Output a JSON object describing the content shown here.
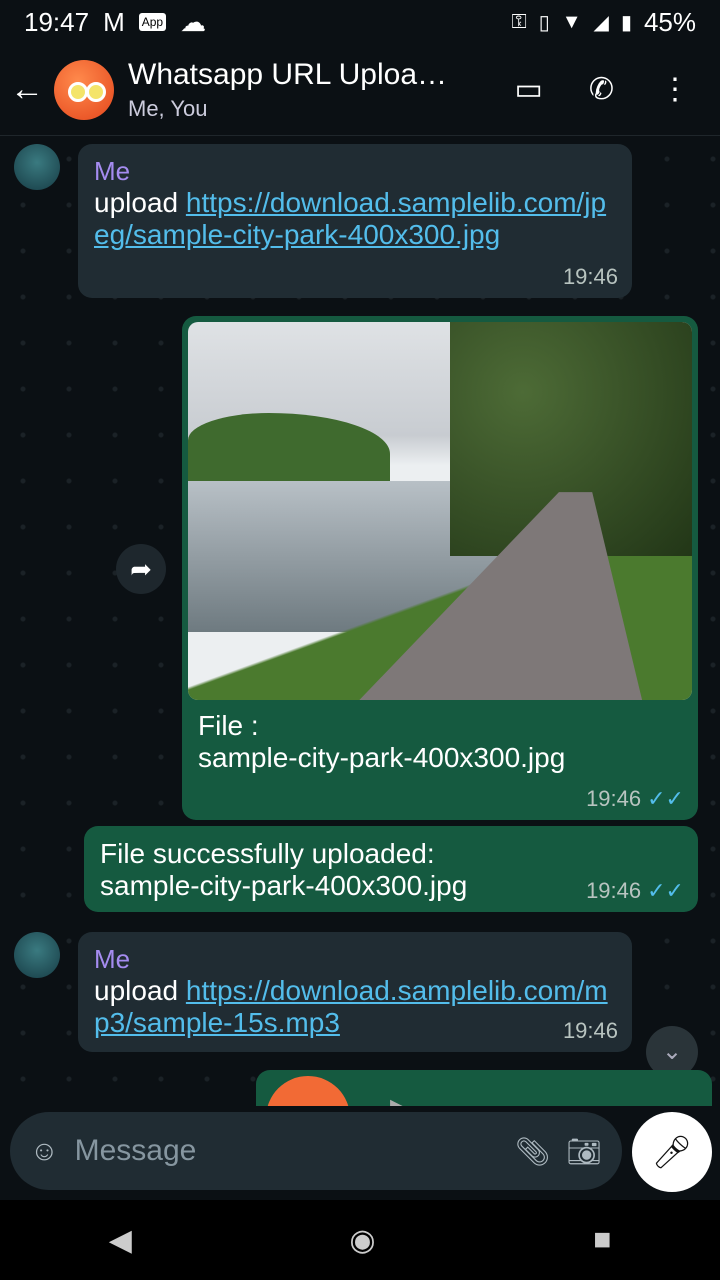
{
  "status_bar": {
    "time": "19:47",
    "battery": "45%",
    "icons": [
      "gmail-icon",
      "app-icon",
      "cloud-icon",
      "vpn-key-icon",
      "vibrate-icon",
      "wifi-icon",
      "signal-icon",
      "battery-icon"
    ]
  },
  "header": {
    "title": "Whatsapp URL Uploa…",
    "subtitle": "Me, You"
  },
  "messages": [
    {
      "sender": "Me",
      "prefix": "upload ",
      "link": "https://download.samplelib.com/jpeg/sample-city-park-400x300.jpg",
      "time": "19:46"
    },
    {
      "caption_line1": "File :",
      "caption_line2": "sample-city-park-400x300.jpg",
      "time": "19:46",
      "ticks": "✓✓"
    },
    {
      "line1": "File successfully uploaded:",
      "line2": "sample-city-park-400x300.jpg",
      "time": "19:46",
      "ticks": "✓✓"
    },
    {
      "sender": "Me",
      "prefix": "upload ",
      "link": "https://download.samplelib.com/mp3/sample-15s.mp3",
      "time": "19:46"
    }
  ],
  "input": {
    "placeholder": "Message"
  },
  "colors": {
    "outgoing": "#155a40",
    "incoming": "#202c33",
    "link": "#53bdeb",
    "sender": "#a58cf0"
  }
}
